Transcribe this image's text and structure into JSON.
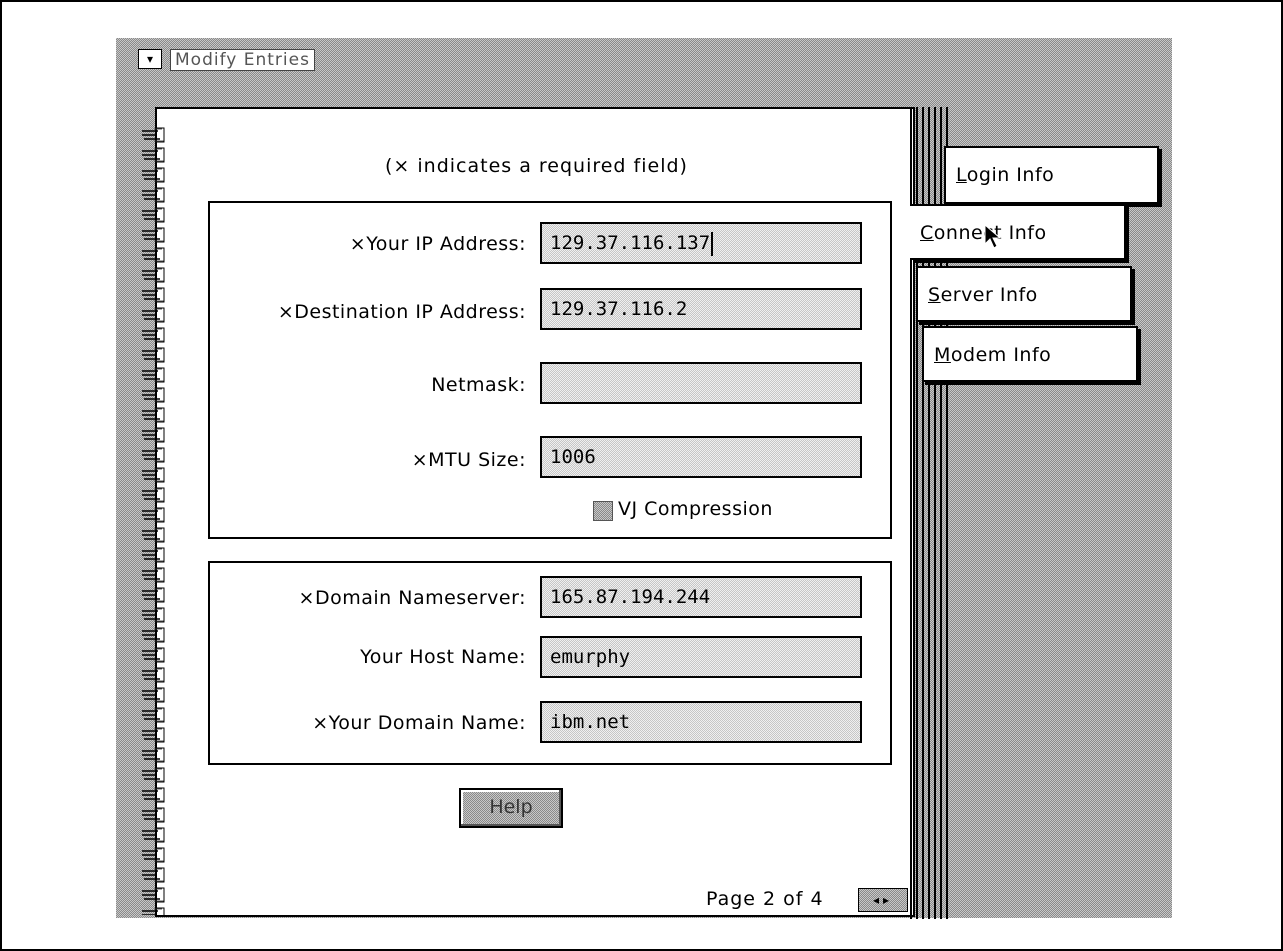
{
  "window": {
    "title": "Modify Entries",
    "sysmenu_glyph": "▾"
  },
  "hint": "(× indicates a required field)",
  "connection": {
    "fields": [
      {
        "label": "×Your IP Address:",
        "value": "129.37.116.137"
      },
      {
        "label": "×Destination IP Address:",
        "value": "129.37.116.2"
      },
      {
        "label": "Netmask:",
        "value": ""
      },
      {
        "label": "×MTU Size:",
        "value": "1006"
      }
    ],
    "vj_compression": {
      "label": "VJ Compression",
      "checked": false
    }
  },
  "dns": {
    "fields": [
      {
        "label": "×Domain Nameserver:",
        "value": "165.87.194.244"
      },
      {
        "label": "Your Host Name:",
        "value": "emurphy"
      },
      {
        "label": "×Your Domain Name:",
        "value": "ibm.net"
      }
    ]
  },
  "help_label": "Help",
  "page_indicator": "Page 2 of 4",
  "page_arrows": "◂▸",
  "tabs": [
    {
      "label": "Login Info",
      "mnemonic": "L",
      "rest": "ogin Info",
      "active": false
    },
    {
      "label": "Connect Info",
      "mnemonic": "C",
      "rest": "onnect Info",
      "active": true
    },
    {
      "label": "Server Info",
      "mnemonic": "S",
      "rest": "erver Info",
      "active": false
    },
    {
      "label": "Modem Info",
      "mnemonic": "M",
      "rest": "odem Info",
      "active": false
    }
  ]
}
